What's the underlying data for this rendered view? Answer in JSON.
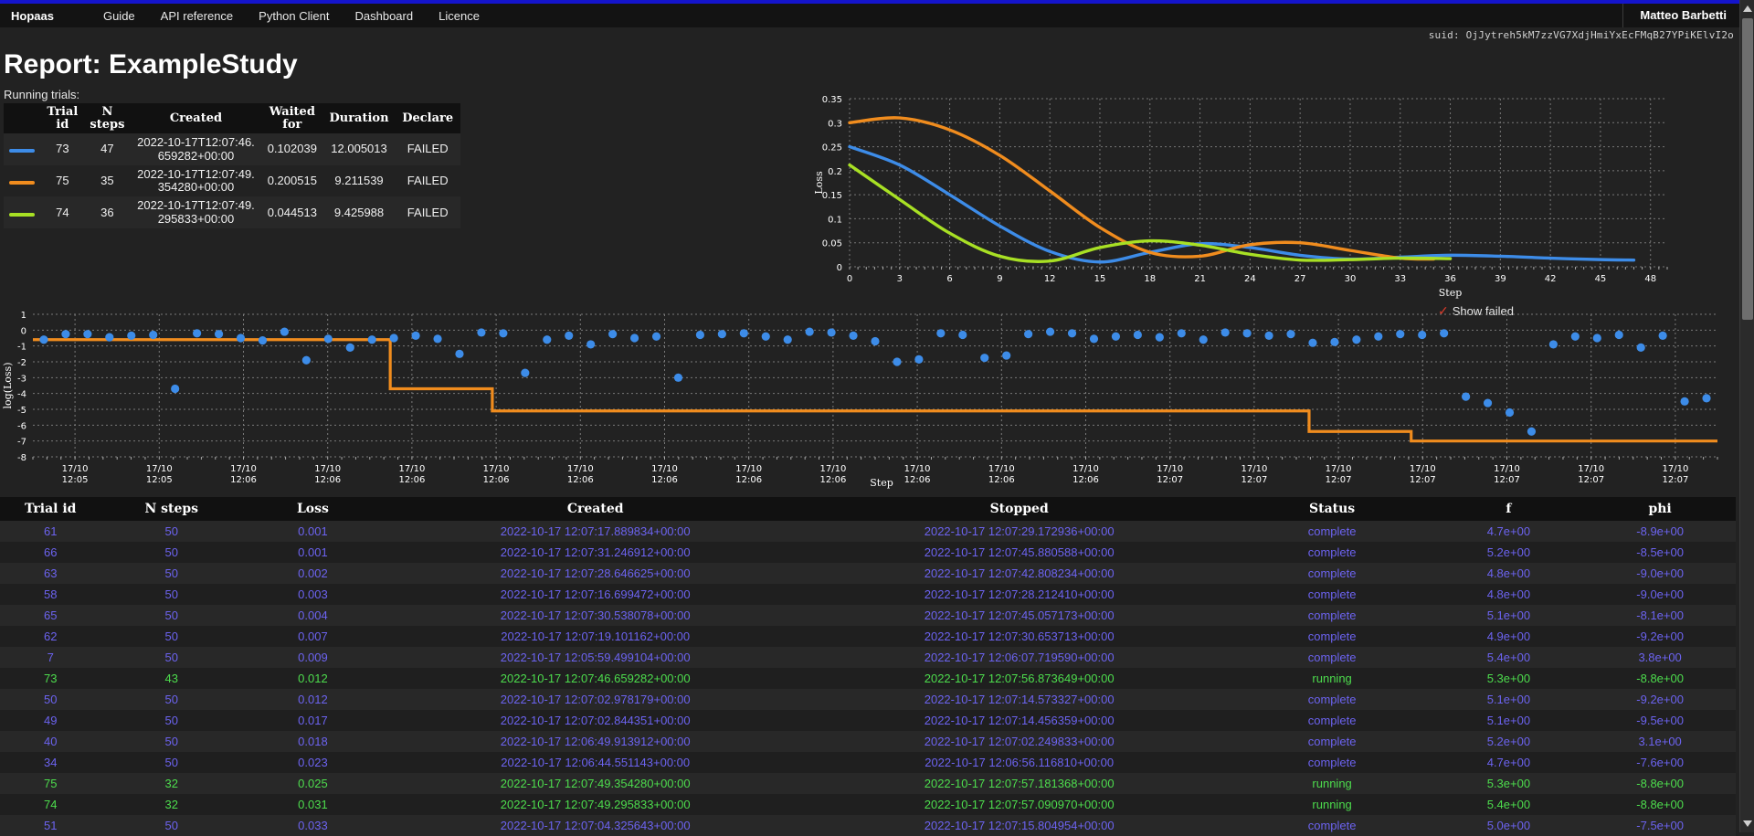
{
  "navbar": {
    "brand": "Hopaas",
    "links": [
      {
        "label": "Guide"
      },
      {
        "label": "API reference"
      },
      {
        "label": "Python Client"
      },
      {
        "label": "Dashboard"
      },
      {
        "label": "Licence"
      }
    ],
    "user": "Matteo Barbetti"
  },
  "suid": "suid: OjJytreh5kM7zzVG7XdjHmiYxEcFMqB27YPiKElvI2o",
  "page_title": "Report: ExampleStudy",
  "running_trials": {
    "caption": "Running trials:",
    "columns": [
      "",
      "Trial id",
      "N steps",
      "Created",
      "Waited for",
      "Duration",
      "Declare"
    ],
    "rows": [
      {
        "color": "#3d8ce8",
        "trial_id": "73",
        "n_steps": "47",
        "created": "2022-10-17T12:07:46.659282+00:00",
        "waited_for": "0.102039",
        "duration": "12.005013",
        "declare": "FAILED"
      },
      {
        "color": "#f08c1e",
        "trial_id": "75",
        "n_steps": "35",
        "created": "2022-10-17T12:07:49.354280+00:00",
        "waited_for": "0.200515",
        "duration": "9.211539",
        "declare": "FAILED"
      },
      {
        "color": "#a8e024",
        "trial_id": "74",
        "n_steps": "36",
        "created": "2022-10-17T12:07:49.295833+00:00",
        "waited_for": "0.044513",
        "duration": "9.425988",
        "declare": "FAILED"
      }
    ]
  },
  "show_failed": {
    "label": "Show failed",
    "checked": true,
    "check_glyph": "✓",
    "check_color": "#d93b2b"
  },
  "chart_data": [
    {
      "type": "line",
      "name": "running-loss-chart",
      "title": "",
      "xlabel": "Step",
      "ylabel": "Loss",
      "xlim": [
        0,
        49
      ],
      "ylim": [
        0,
        0.35
      ],
      "xticks": [
        0,
        3,
        6,
        9,
        12,
        15,
        18,
        21,
        24,
        27,
        30,
        33,
        36,
        39,
        42,
        45,
        48
      ],
      "yticks": [
        0,
        0.05,
        0.1,
        0.15,
        0.2,
        0.25,
        0.3,
        0.35
      ],
      "grid": true,
      "legend": "none",
      "series": [
        {
          "name": "73",
          "color": "#3d8ce8",
          "x": [
            0,
            3,
            6,
            9,
            12,
            15,
            18,
            21,
            24,
            27,
            30,
            33,
            36,
            39,
            42,
            45,
            47
          ],
          "y": [
            0.25,
            0.212,
            0.15,
            0.085,
            0.032,
            0.01,
            0.03,
            0.048,
            0.04,
            0.024,
            0.016,
            0.02,
            0.024,
            0.022,
            0.018,
            0.015,
            0.014
          ]
        },
        {
          "name": "75",
          "color": "#f08c1e",
          "x": [
            0,
            3,
            6,
            9,
            12,
            15,
            18,
            21,
            24,
            27,
            30,
            33,
            35
          ],
          "y": [
            0.3,
            0.31,
            0.285,
            0.232,
            0.158,
            0.082,
            0.03,
            0.022,
            0.046,
            0.05,
            0.034,
            0.018,
            0.016
          ]
        },
        {
          "name": "74",
          "color": "#a8e024",
          "x": [
            0,
            3,
            6,
            9,
            12,
            15,
            18,
            21,
            24,
            27,
            30,
            33,
            36
          ],
          "y": [
            0.212,
            0.14,
            0.07,
            0.022,
            0.012,
            0.04,
            0.054,
            0.045,
            0.026,
            0.014,
            0.015,
            0.018,
            0.017
          ]
        }
      ]
    },
    {
      "type": "scatter",
      "name": "log-loss-history",
      "title": "",
      "xlabel": "Step",
      "ylabel": "log(Loss)",
      "ylim": [
        -8,
        1
      ],
      "yticks": [
        1,
        0,
        -1,
        -2,
        -3,
        -4,
        -5,
        -6,
        -7,
        -8
      ],
      "xticks": [
        "17/10\n12:05",
        "17/10\n12:05",
        "17/10\n12:06",
        "17/10\n12:06",
        "17/10\n12:06",
        "17/10\n12:06",
        "17/10\n12:06",
        "17/10\n12:06",
        "17/10\n12:06",
        "17/10\n12:06",
        "17/10\n12:06",
        "17/10\n12:06",
        "17/10\n12:06",
        "17/10\n12:07",
        "17/10\n12:07",
        "17/10\n12:07",
        "17/10\n12:07",
        "17/10\n12:07",
        "17/10\n12:07",
        "17/10\n12:07"
      ],
      "grid": true,
      "point_color": "#3d8ce8",
      "step_color": "#f08c1e",
      "points_y": [
        -0.6,
        -0.25,
        -0.25,
        -0.45,
        -0.35,
        -0.3,
        -3.7,
        -0.2,
        -0.25,
        -0.5,
        -0.65,
        -0.1,
        -1.9,
        -0.55,
        -1.1,
        -0.6,
        -0.5,
        -0.35,
        -0.55,
        -1.5,
        -0.15,
        -0.2,
        -2.7,
        -0.6,
        -0.35,
        -0.9,
        -0.25,
        -0.5,
        -0.4,
        -3.0,
        -0.3,
        -0.25,
        -0.2,
        -0.4,
        -0.6,
        -0.1,
        -0.15,
        -0.35,
        -0.7,
        -2.0,
        -1.85,
        -0.2,
        -0.3,
        -1.75,
        -1.6,
        -0.25,
        -0.1,
        -0.2,
        -0.55,
        -0.4,
        -0.3,
        -0.45,
        -0.2,
        -0.6,
        -0.15,
        -0.2,
        -0.35,
        -0.25,
        -0.8,
        -0.75,
        -0.6,
        -0.4,
        -0.25,
        -0.3,
        -0.2,
        -4.2,
        -4.6,
        -5.2,
        -6.4,
        -0.9,
        -0.4,
        -0.5,
        -0.3,
        -1.1,
        -0.35,
        -4.5,
        -4.3
      ],
      "step_y": [
        -0.6,
        -0.6,
        -0.6,
        -0.6,
        -0.6,
        -0.6,
        -0.6,
        -3.7,
        -3.7,
        -5.1,
        -5.1,
        -5.1,
        -5.1,
        -5.1,
        -5.1,
        -5.1,
        -5.1,
        -5.1,
        -5.1,
        -5.1,
        -5.1,
        -5.1,
        -5.1,
        -5.1,
        -5.1,
        -6.4,
        -6.4,
        -7.0,
        -7.0,
        -7.0,
        -7.0,
        -7.0,
        -7.0
      ]
    }
  ],
  "trials_table": {
    "columns": [
      "Trial id",
      "N steps",
      "Loss",
      "Created",
      "Stopped",
      "Status",
      "f",
      "phi"
    ],
    "rows": [
      {
        "trial_id": "61",
        "n_steps": "50",
        "loss": "0.001",
        "created": "2022-10-17 12:07:17.889834+00:00",
        "stopped": "2022-10-17 12:07:29.172936+00:00",
        "status": "complete",
        "f": "4.7e+00",
        "phi": "-8.9e+00"
      },
      {
        "trial_id": "66",
        "n_steps": "50",
        "loss": "0.001",
        "created": "2022-10-17 12:07:31.246912+00:00",
        "stopped": "2022-10-17 12:07:45.880588+00:00",
        "status": "complete",
        "f": "5.2e+00",
        "phi": "-8.5e+00"
      },
      {
        "trial_id": "63",
        "n_steps": "50",
        "loss": "0.002",
        "created": "2022-10-17 12:07:28.646625+00:00",
        "stopped": "2022-10-17 12:07:42.808234+00:00",
        "status": "complete",
        "f": "4.8e+00",
        "phi": "-9.0e+00"
      },
      {
        "trial_id": "58",
        "n_steps": "50",
        "loss": "0.003",
        "created": "2022-10-17 12:07:16.699472+00:00",
        "stopped": "2022-10-17 12:07:28.212410+00:00",
        "status": "complete",
        "f": "4.8e+00",
        "phi": "-9.0e+00"
      },
      {
        "trial_id": "65",
        "n_steps": "50",
        "loss": "0.004",
        "created": "2022-10-17 12:07:30.538078+00:00",
        "stopped": "2022-10-17 12:07:45.057173+00:00",
        "status": "complete",
        "f": "5.1e+00",
        "phi": "-8.1e+00"
      },
      {
        "trial_id": "62",
        "n_steps": "50",
        "loss": "0.007",
        "created": "2022-10-17 12:07:19.101162+00:00",
        "stopped": "2022-10-17 12:07:30.653713+00:00",
        "status": "complete",
        "f": "4.9e+00",
        "phi": "-9.2e+00"
      },
      {
        "trial_id": "7",
        "n_steps": "50",
        "loss": "0.009",
        "created": "2022-10-17 12:05:59.499104+00:00",
        "stopped": "2022-10-17 12:06:07.719590+00:00",
        "status": "complete",
        "f": "5.4e+00",
        "phi": "3.8e+00"
      },
      {
        "trial_id": "73",
        "n_steps": "43",
        "loss": "0.012",
        "created": "2022-10-17 12:07:46.659282+00:00",
        "stopped": "2022-10-17 12:07:56.873649+00:00",
        "status": "running",
        "f": "5.3e+00",
        "phi": "-8.8e+00"
      },
      {
        "trial_id": "50",
        "n_steps": "50",
        "loss": "0.012",
        "created": "2022-10-17 12:07:02.978179+00:00",
        "stopped": "2022-10-17 12:07:14.573327+00:00",
        "status": "complete",
        "f": "5.1e+00",
        "phi": "-9.2e+00"
      },
      {
        "trial_id": "49",
        "n_steps": "50",
        "loss": "0.017",
        "created": "2022-10-17 12:07:02.844351+00:00",
        "stopped": "2022-10-17 12:07:14.456359+00:00",
        "status": "complete",
        "f": "5.1e+00",
        "phi": "-9.5e+00"
      },
      {
        "trial_id": "40",
        "n_steps": "50",
        "loss": "0.018",
        "created": "2022-10-17 12:06:49.913912+00:00",
        "stopped": "2022-10-17 12:07:02.249833+00:00",
        "status": "complete",
        "f": "5.2e+00",
        "phi": "3.1e+00"
      },
      {
        "trial_id": "34",
        "n_steps": "50",
        "loss": "0.023",
        "created": "2022-10-17 12:06:44.551143+00:00",
        "stopped": "2022-10-17 12:06:56.116810+00:00",
        "status": "complete",
        "f": "4.7e+00",
        "phi": "-7.6e+00"
      },
      {
        "trial_id": "75",
        "n_steps": "32",
        "loss": "0.025",
        "created": "2022-10-17 12:07:49.354280+00:00",
        "stopped": "2022-10-17 12:07:57.181368+00:00",
        "status": "running",
        "f": "5.3e+00",
        "phi": "-8.8e+00"
      },
      {
        "trial_id": "74",
        "n_steps": "32",
        "loss": "0.031",
        "created": "2022-10-17 12:07:49.295833+00:00",
        "stopped": "2022-10-17 12:07:57.090970+00:00",
        "status": "running",
        "f": "5.4e+00",
        "phi": "-8.8e+00"
      },
      {
        "trial_id": "51",
        "n_steps": "50",
        "loss": "0.033",
        "created": "2022-10-17 12:07:04.325643+00:00",
        "stopped": "2022-10-17 12:07:15.804954+00:00",
        "status": "complete",
        "f": "5.0e+00",
        "phi": "-7.5e+00"
      }
    ]
  }
}
